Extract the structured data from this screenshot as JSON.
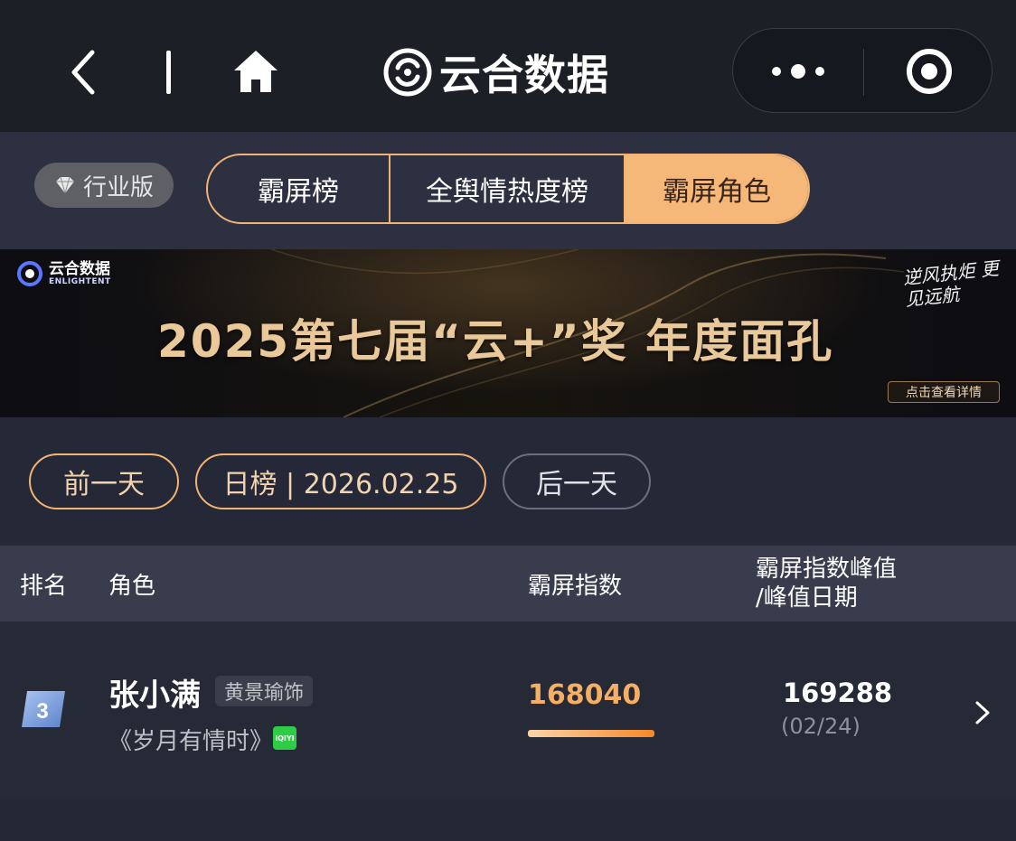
{
  "nav": {
    "title": "云合数据"
  },
  "edition": {
    "label": "行业版"
  },
  "tabs": [
    {
      "label": "霸屏榜",
      "active": false
    },
    {
      "label": "全舆情热度榜",
      "active": false
    },
    {
      "label": "霸屏角色",
      "active": true
    }
  ],
  "banner": {
    "logo_cn": "云合数据",
    "logo_en": "ENLIGHTENT",
    "headline": "2025第七届“云+”奖  年度面孔",
    "slogan": "逆风执炬 更见远航",
    "detail_button": "点击查看详情"
  },
  "date_controls": {
    "prev": "前一天",
    "current": "日榜 | 2026.02.25",
    "next": "后一天"
  },
  "table": {
    "headers": {
      "rank": "排名",
      "role": "角色",
      "index": "霸屏指数",
      "peak_line1": "霸屏指数峰值",
      "peak_line2": "/峰值日期"
    },
    "rows": [
      {
        "rank": "3",
        "role": "张小满",
        "actor": "黄景瑜饰",
        "drama": "《岁月有情时》",
        "platform": "iQIYI",
        "index": "168040",
        "peak": "169288",
        "peak_date": "(02/24)"
      }
    ]
  },
  "colors": {
    "accent": "#f6b878",
    "index_value": "#f6ae63",
    "platform_green": "#2fcc46"
  }
}
